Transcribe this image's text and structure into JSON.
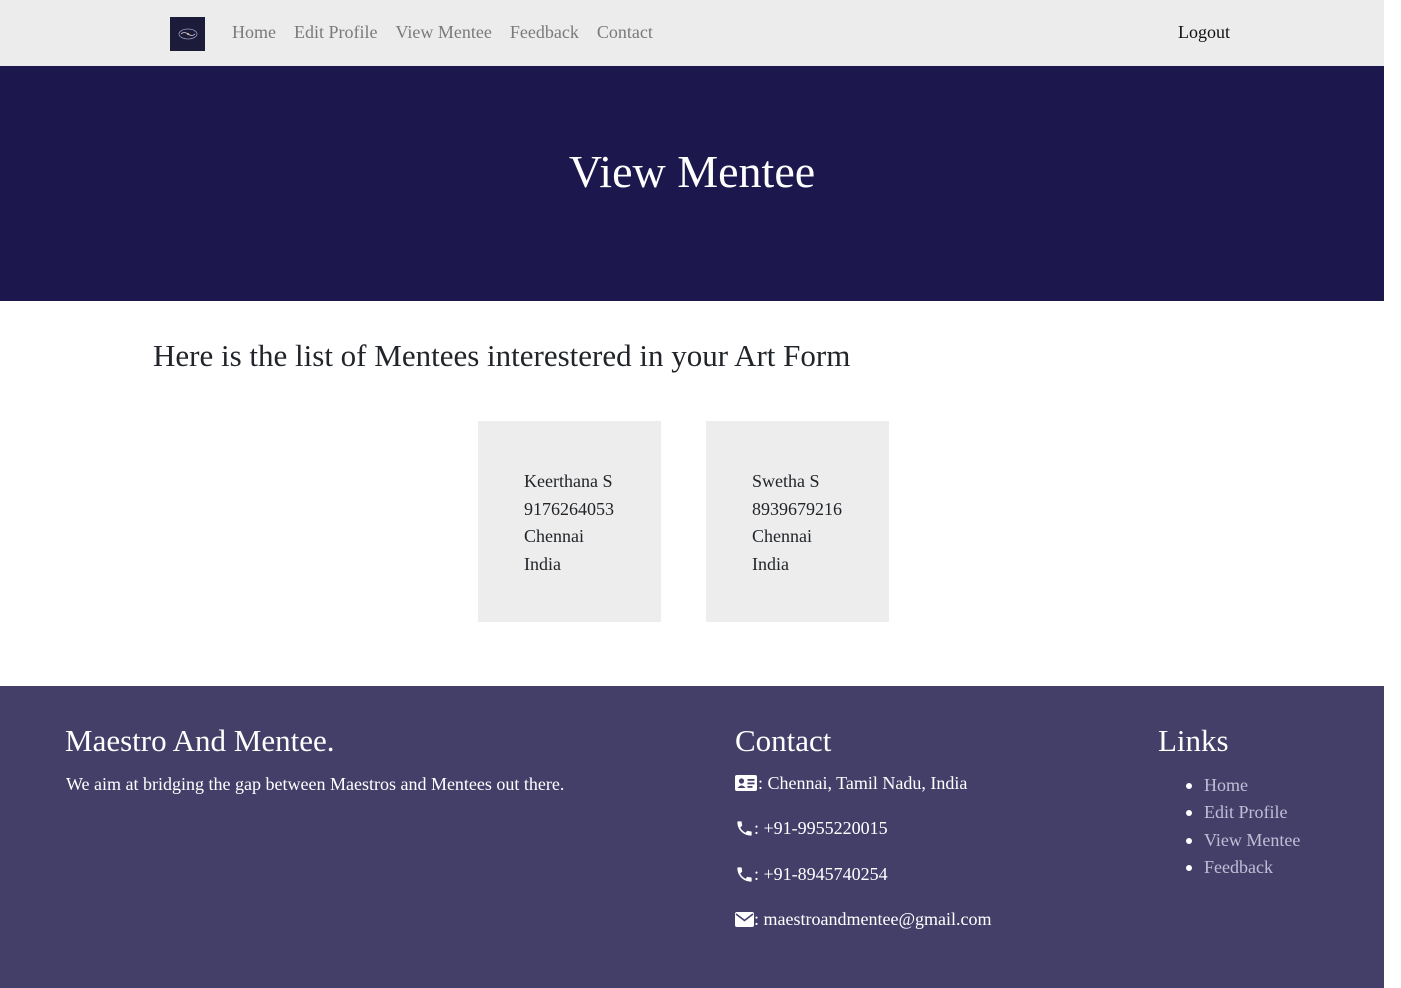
{
  "nav": {
    "logo_alt": "logo",
    "links": [
      "Home",
      "Edit Profile",
      "View Mentee",
      "Feedback",
      "Contact"
    ],
    "logout": "Logout"
  },
  "hero": {
    "title": "View Mentee"
  },
  "main": {
    "heading": "Here is the list of Mentees interestered in your Art Form",
    "mentees": [
      {
        "name": "Keerthana S",
        "phone": "9176264053",
        "city": "Chennai",
        "country": "India"
      },
      {
        "name": "Swetha S",
        "phone": "8939679216",
        "city": "Chennai",
        "country": "India"
      }
    ]
  },
  "footer": {
    "brand_title": "Maestro And Mentee.",
    "tagline": "We aim at bridging the gap between Maestros and Mentees out there.",
    "contact_title": "Contact",
    "address": ": Chennai, Tamil Nadu, India",
    "phone1": ": +91-9955220015",
    "phone2": ": +91-8945740254",
    "email": ": maestroandmentee@gmail.com",
    "links_title": "Links",
    "links": [
      "Home",
      "Edit Profile",
      "View Mentee",
      "Feedback"
    ]
  },
  "colors": {
    "navbar_bg": "#ececec",
    "hero_bg": "#1c184d",
    "card_bg": "#ededed",
    "footer_bg": "#433f69",
    "footer_link": "#c0bed6"
  },
  "icons": [
    "address-card-icon",
    "phone-icon",
    "envelope-icon"
  ]
}
